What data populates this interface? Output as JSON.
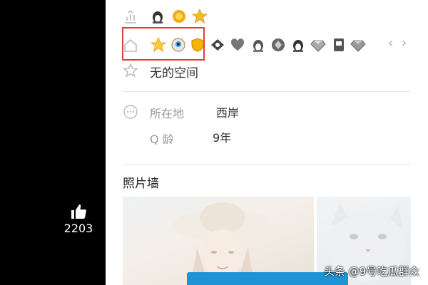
{
  "likes": {
    "count": "2203",
    "icon": "thumbs-up-icon"
  },
  "profile": {
    "space_name": "无的空间",
    "location": {
      "label": "所在地",
      "value": "西岸"
    },
    "q_age": {
      "label": "Q 龄",
      "value": "9年"
    }
  },
  "badges_row1": [
    "penguin-icon",
    "sun-icon",
    "star-icon"
  ],
  "badges_row2": [
    "star-icon",
    "eye-orb-icon",
    "shield-icon",
    "diamond-penguin-icon",
    "heart-icon",
    "penguin-icon",
    "diamond-icon",
    "penguin-icon",
    "gem-icon",
    "card-icon",
    "gem-icon"
  ],
  "nav": {
    "prev": "‹",
    "next": "›"
  },
  "photo_wall": {
    "title": "照片墙"
  },
  "watermark": "头条 @9号吃瓜群众",
  "colors": {
    "highlight": "#e03c3c",
    "button": "#1f93d6",
    "divider": "#e6e6e6"
  }
}
